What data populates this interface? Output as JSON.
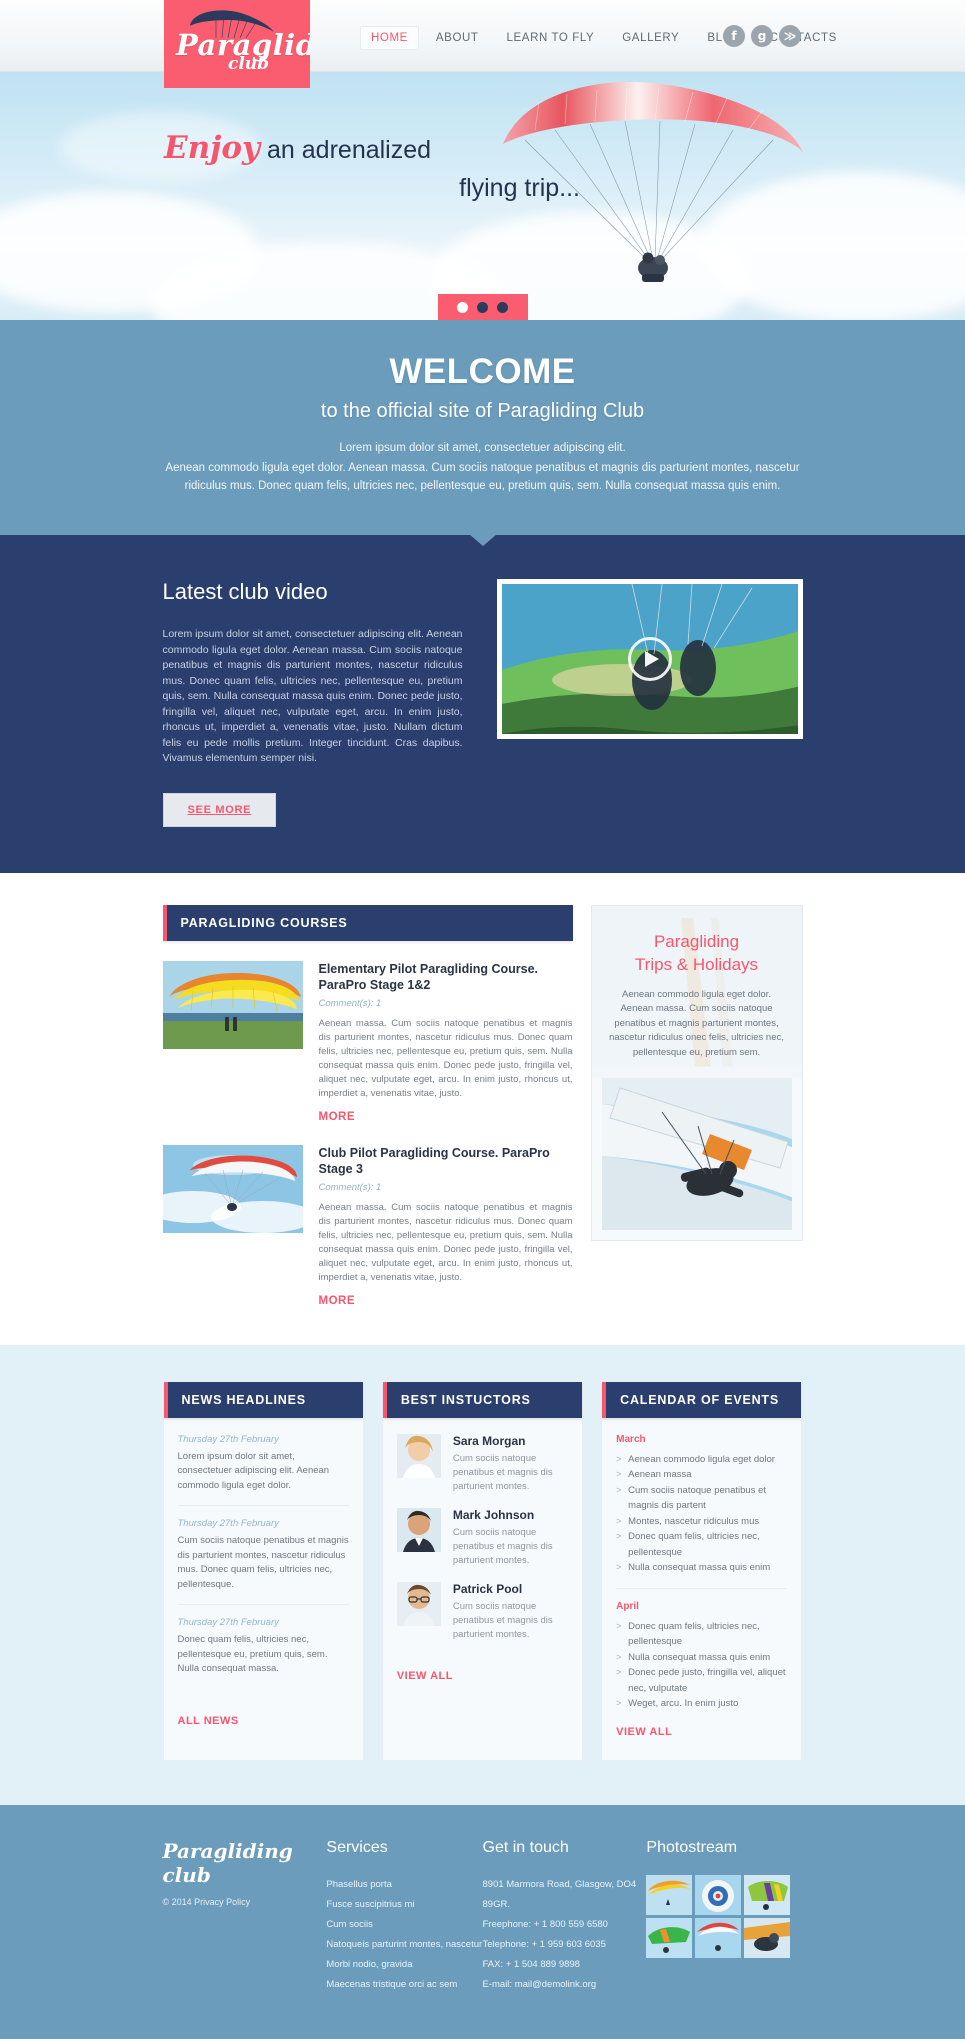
{
  "header": {
    "logo": {
      "word": "Paragliding",
      "sub": "club",
      "icon": "paraglider-logo-icon"
    },
    "nav": [
      {
        "label": "HOME",
        "active": true
      },
      {
        "label": "ABOUT",
        "active": false
      },
      {
        "label": "LEARN TO FLY",
        "active": false
      },
      {
        "label": "GALLERY",
        "active": false
      },
      {
        "label": "BLOG",
        "active": false
      },
      {
        "label": "CONTACTS",
        "active": false
      }
    ],
    "socials": [
      {
        "name": "facebook-icon",
        "glyph": "f"
      },
      {
        "name": "google-plus-icon",
        "glyph": "g"
      },
      {
        "name": "rss-icon",
        "glyph": "≫"
      }
    ]
  },
  "slider": {
    "line1_accent": "Enjoy",
    "line1_rest": " an adrenalized",
    "line2": "flying trip...",
    "dots": 3,
    "active_dot": 1
  },
  "welcome": {
    "title": "WELCOME",
    "subtitle": "to the official site of Paragliding Club",
    "paragraph_1": "Lorem ipsum dolor sit amet, consectetuer adipiscing elit.",
    "paragraph_2": "Aenean commodo ligula eget dolor. Aenean massa. Cum sociis natoque penatibus et magnis dis parturient montes, nascetur ridiculus mus. Donec quam felis, ultricies nec, pellentesque eu, pretium quis, sem. Nulla consequat massa quis enim."
  },
  "video": {
    "heading": "Latest club video",
    "text": "Lorem ipsum dolor sit amet, consectetuer adipiscing elit. Aenean commodo ligula eget dolor. Aenean massa. Cum sociis natoque penatibus et magnis dis parturient montes, nascetur ridiculus mus. Donec quam felis, ultricies nec, pellentesque eu, pretium quis, sem. Nulla consequat massa quis enim. Donec pede justo, fringilla vel, aliquet nec, vulputate eget, arcu. In enim justo, rhoncus ut, imperdiet a, venenatis vitae, justo. Nullam dictum felis eu pede mollis pretium. Integer tincidunt. Cras dapibus. Vivamus elementum semper nisi.",
    "button": "SEE MORE",
    "play_icon": "play-button-icon"
  },
  "courses": {
    "panel_title": "PARAGLIDING COURSES",
    "items": [
      {
        "title": "Elementary Pilot Paragliding Course. ParaPro Stage 1&2",
        "comments": "Comment(s): 1",
        "text": "Aenean massa. Cum sociis natoque penatibus et magnis dis parturient montes, nascetur ridiculus mus. Donec quam felis, ultricies nec, pellentesque eu, pretium quis, sem. Nulla consequat massa quis enim. Donec pede justo, fringilla vel, aliquet nec, vulputate eget, arcu. In enim justo, rhoncus ut, imperdiet a, venenatis vitae, justo.",
        "more": "MORE"
      },
      {
        "title": "Club Pilot Paragliding Course. ParaPro Stage 3",
        "comments": "Comment(s): 1",
        "text": "Aenean massa. Cum sociis natoque penatibus et magnis dis parturient montes, nascetur ridiculus mus. Donec quam felis, ultricies nec, pellentesque eu, pretium quis, sem. Nulla consequat massa quis enim. Donec pede justo, fringilla vel, aliquet nec, vulputate eget, arcu. In enim justo, rhoncus ut, imperdiet a, venenatis vitae, justo.",
        "more": "MORE"
      }
    ]
  },
  "sidebar_promo": {
    "title_line1": "Paragliding",
    "title_line2": "Trips & Holidays",
    "text": "Aenean commodo ligula eget dolor. Aenean massa. Cum sociis natoque penatibus et magnis parturient montes, nascetur ridiculus onec felis, ultricies nec, pellentesque eu, pretium sem."
  },
  "news": {
    "panel_title": "NEWS HEADLINES",
    "items": [
      {
        "date": "Thursday 27th February",
        "text": "Lorem ipsum dolor sit amet, consectetuer adipiscing elit. Aenean commodo ligula eget dolor."
      },
      {
        "date": "Thursday 27th February",
        "text": "Cum sociis natoque penatibus et magnis dis parturient montes, nascetur ridiculus mus. Donec quam felis, ultricies nec, pellentesque."
      },
      {
        "date": "Thursday 27th February",
        "text": "Donec quam felis, ultricies nec, pellentesque eu, pretium quis, sem. Nulla consequat massa."
      }
    ],
    "link": "ALL NEWS"
  },
  "instructors": {
    "panel_title": "BEST INSTUCTORS",
    "items": [
      {
        "name": "Sara Morgan",
        "desc": "Cum sociis natoque penatibus et magnis dis parturient montes."
      },
      {
        "name": "Mark Johnson",
        "desc": "Cum sociis natoque penatibus et magnis dis parturient montes."
      },
      {
        "name": "Patrick Pool",
        "desc": "Cum sociis natoque penatibus et magnis dis parturient montes."
      }
    ],
    "link": "VIEW ALL"
  },
  "calendar": {
    "panel_title": "CALENDAR OF EVENTS",
    "groups": [
      {
        "month": "March",
        "events": [
          "Aenean commodo ligula eget dolor",
          "Aenean massa",
          "Cum sociis natoque penatibus et magnis dis partent",
          "Montes, nascetur ridiculus mus",
          "Donec quam felis, ultricies nec, pellentesque",
          "Nulla consequat massa quis enim"
        ]
      },
      {
        "month": "April",
        "events": [
          "Donec quam felis, ultricies nec, pellentesque",
          "Nulla consequat massa quis enim",
          "Donec pede justo, fringilla vel, aliquet nec, vulputate",
          "Weget, arcu. In enim justo"
        ]
      }
    ],
    "link": "VIEW ALL"
  },
  "footer": {
    "logo": "Paragliding club",
    "copyright": "© 2014  Privacy Policy",
    "services": {
      "heading": "Services",
      "items": [
        "Phasellus porta",
        "Fusce suscipitrius mi",
        "Cum sociis",
        "Natoqueis parturint montes, nascetur",
        "Morbi nodio, gravida",
        "Maecenas tristique orci ac sem"
      ]
    },
    "contact": {
      "heading": "Get in touch",
      "items": [
        "8901 Marmora Road,  Glasgow, DO4 89GR.",
        "Freephone: + 1 800 559 6580",
        "Telephone: + 1 959 603 6035",
        "FAX: + 1 504 889 9898",
        "",
        "E-mail: mail@demolink.org"
      ]
    },
    "photostream": {
      "heading": "Photostream",
      "count": 6
    }
  },
  "colors": {
    "brand_pink": "#fa5d70",
    "navy": "#2b3f6e",
    "steel_blue": "#6b9cbb",
    "pale_blue": "#e2f0f7"
  }
}
